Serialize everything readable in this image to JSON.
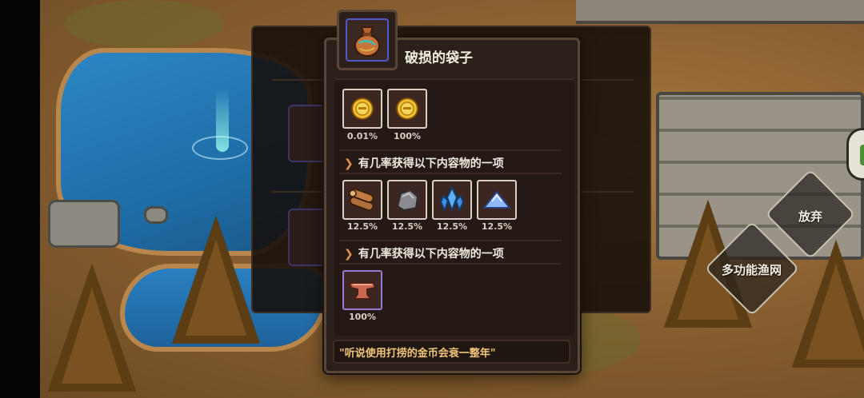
{
  "popup": {
    "title": "破损的袋子",
    "item_icon": "cloth-bag-icon",
    "guaranteed": [
      {
        "icon": "gold-coin-icon",
        "chance": "0.01%"
      },
      {
        "icon": "gold-coin-icon",
        "chance": "100%"
      }
    ],
    "section1": {
      "heading": "有几率获得以下内容物的一项",
      "items": [
        {
          "icon": "wood-logs-icon",
          "chance": "12.5%"
        },
        {
          "icon": "stone-ore-icon",
          "chance": "12.5%"
        },
        {
          "icon": "blue-crystal-icon",
          "chance": "12.5%"
        },
        {
          "icon": "blue-powder-icon",
          "chance": "12.5%"
        }
      ]
    },
    "section2": {
      "heading": "有几率获得以下内容物的一项",
      "items": [
        {
          "icon": "anvil-icon",
          "chance": "100%"
        }
      ]
    },
    "flavor_text": "\"听说使用打捞的金币会衰一整年\""
  },
  "actions": {
    "discard_label": "放弃",
    "multi_net_label": "多功能渔网"
  },
  "colors": {
    "popup_bg": "#2b1f1a",
    "quote_text": "#f2c67a",
    "epic_border": "#9a78d6",
    "accent_chevron": "#e3914a"
  }
}
